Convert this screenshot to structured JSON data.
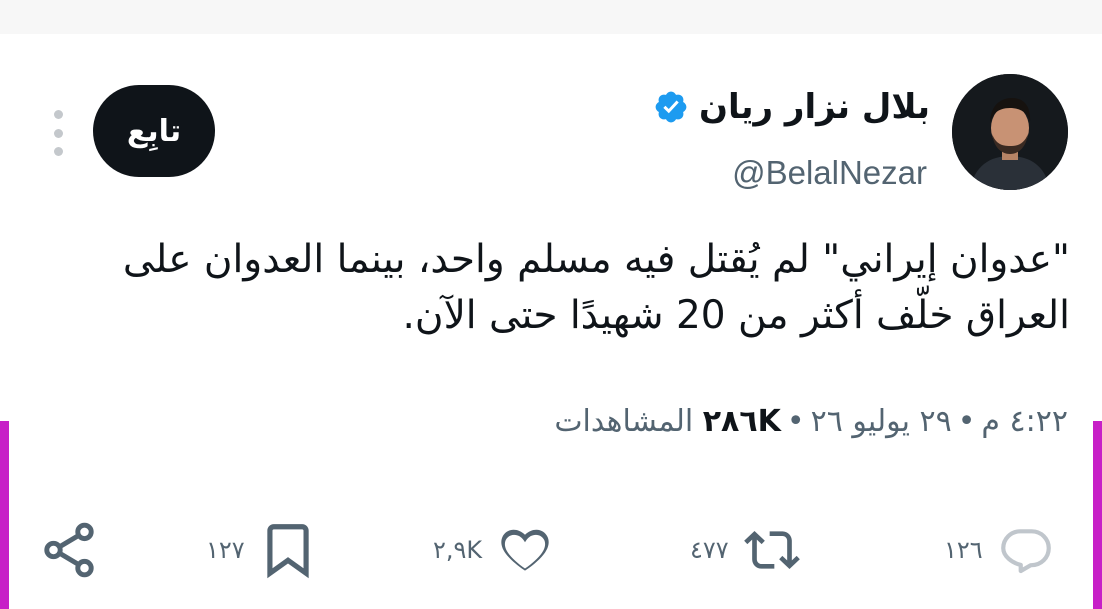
{
  "colors": {
    "text_primary": "#0f1419",
    "text_secondary": "#536471",
    "verified_blue": "#1d9bf0",
    "follow_bg": "#0f1419",
    "edge_accent": "#c71fc7"
  },
  "author": {
    "display_name": "بلال نزار ريان",
    "handle": "@BelalNezar",
    "verified": true
  },
  "follow_button": {
    "label": "تابِع"
  },
  "tweet": {
    "text": "\"عدوان إيراني\" لم يُقتل فيه مسلم واحد، بينما العدوان على العراق خلّف أكثر من 20 شهيدًا حتى الآن."
  },
  "meta": {
    "time": "٤:٢٢ م",
    "date": "٢٩ يوليو ٢٦",
    "views_count": "٢٨٦K",
    "views_label": "المشاهدات"
  },
  "actions": {
    "replies": "١٢٦",
    "retweets": "٤٧٧",
    "likes": "٢,٩K",
    "bookmarks": "١٢٧"
  },
  "icons": [
    "more-vertical-icon",
    "verified-badge-icon",
    "reply-icon",
    "retweet-icon",
    "like-icon",
    "bookmark-icon",
    "share-icon"
  ]
}
